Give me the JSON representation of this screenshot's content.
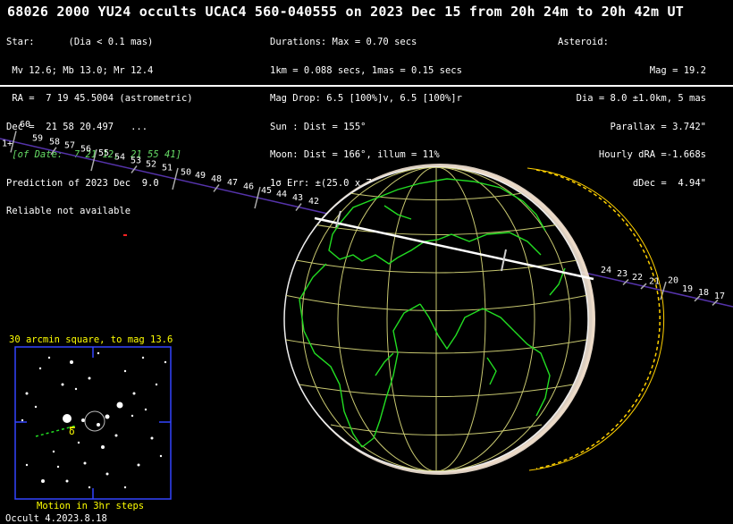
{
  "title": "68026 2000 YU24 occults UCAC4 560-040555 on 2023 Dec 15 from 20h 24m to 20h 42m UT",
  "star": {
    "l1": "Star:      (Dia < 0.1 mas)",
    "l2": " Mv 12.6; Mb 13.0; Mr 12.4",
    "l3": " RA =  7 19 45.5004 (astrometric)",
    "l4": "Dec =  21 58 20.497   ...",
    "l5": " [of Date:  7 21 12,  21 55 41]",
    "l6": "Prediction of 2023 Dec  9.0",
    "l7": "Reliable not available"
  },
  "durations": {
    "l1": "Durations: Max = 0.70 secs",
    "l2": "1km = 0.088 secs, 1mas = 0.15 secs",
    "l3": "Mag Drop: 6.5 [100%]v, 6.5 [100%]r",
    "l4": "Sun : Dist = 155°",
    "l5": "Moon: Dist = 166°, illum = 11%",
    "l6": "1σ Err: ±(25.0 x 7.0) mas in PA 95°"
  },
  "asteroid": {
    "l1": "Asteroid:",
    "l2": "Mag = 19.2",
    "l3": "Dia = 8.0 ±1.0km, 5 mas",
    "l4": "Parallax = 3.742\"",
    "l5": "Hourly dRA =-1.668s",
    "l6": "dDec =  4.94\""
  },
  "path_labels_left": [
    "60",
    "59",
    "58",
    "57",
    "56",
    "55",
    "54",
    "53",
    "52",
    "51",
    "50",
    "49",
    "48",
    "47",
    "46",
    "45",
    "44",
    "43",
    "42"
  ],
  "path_labels_right": [
    "24",
    "23",
    "22",
    "21",
    "20",
    "19",
    "18",
    "17"
  ],
  "path_edge_label": "1+",
  "inset": {
    "title": "30 arcmin square, to mag 13.6",
    "footer": "Motion in 3hr steps",
    "marker": "δ"
  },
  "version": "Occult 4.2023.8.18",
  "colors": {
    "coast": "#22dd22",
    "grid": "#c8c870",
    "path": "#5533aa",
    "inset": "#ffff00",
    "inset_frame": "#3344ff"
  }
}
